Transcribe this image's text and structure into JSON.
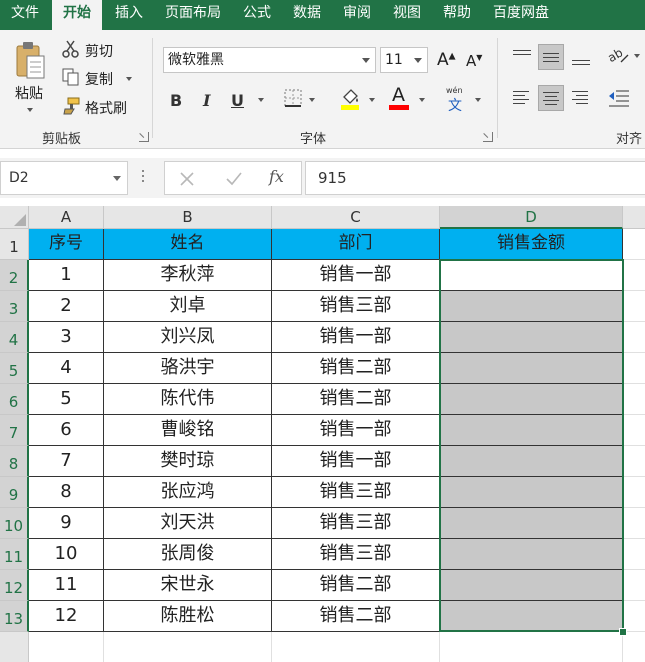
{
  "ribbon": {
    "tabs": [
      "文件",
      "开始",
      "插入",
      "页面布局",
      "公式",
      "数据",
      "审阅",
      "视图",
      "帮助",
      "百度网盘"
    ],
    "active_tab": 1,
    "clipboard": {
      "paste": "粘贴",
      "cut": "剪切",
      "copy": "复制",
      "format_painter": "格式刷",
      "group_label": "剪贴板"
    },
    "font": {
      "font_name": "微软雅黑",
      "font_size": "11",
      "bold": "B",
      "italic": "I",
      "underline": "U",
      "grow": "A",
      "shrink": "A",
      "phonetic_top": "wén",
      "phonetic_bottom": "文",
      "font_color_letter": "A",
      "group_label": "字体",
      "highlight_color": "#ffff00",
      "font_color": "#ff0000"
    },
    "alignment": {
      "group_label": "对齐"
    }
  },
  "formula_bar": {
    "name_box": "D2",
    "fx": "fx",
    "value": "915"
  },
  "sheet": {
    "columns": [
      "A",
      "B",
      "C",
      "D"
    ],
    "rows": [
      "1",
      "2",
      "3",
      "4",
      "5",
      "6",
      "7",
      "8",
      "9",
      "10",
      "11",
      "12",
      "13"
    ],
    "header": [
      "序号",
      "姓名",
      "部门",
      "销售金额"
    ],
    "data": [
      [
        "1",
        "李秋萍",
        "销售一部",
        ""
      ],
      [
        "2",
        "刘卓",
        "销售三部",
        ""
      ],
      [
        "3",
        "刘兴凤",
        "销售一部",
        ""
      ],
      [
        "4",
        "骆洪宇",
        "销售二部",
        ""
      ],
      [
        "5",
        "陈代伟",
        "销售二部",
        ""
      ],
      [
        "6",
        "曹峻铭",
        "销售一部",
        ""
      ],
      [
        "7",
        "樊时琼",
        "销售一部",
        ""
      ],
      [
        "8",
        "张应鸿",
        "销售三部",
        ""
      ],
      [
        "9",
        "刘天洪",
        "销售三部",
        ""
      ],
      [
        "10",
        "张周俊",
        "销售三部",
        ""
      ],
      [
        "11",
        "宋世永",
        "销售二部",
        ""
      ],
      [
        "12",
        "陈胜松",
        "销售二部",
        ""
      ]
    ],
    "header_color": "#00b0f0",
    "selection_color": "#217346",
    "selected_fill": "#c8c8c8"
  }
}
